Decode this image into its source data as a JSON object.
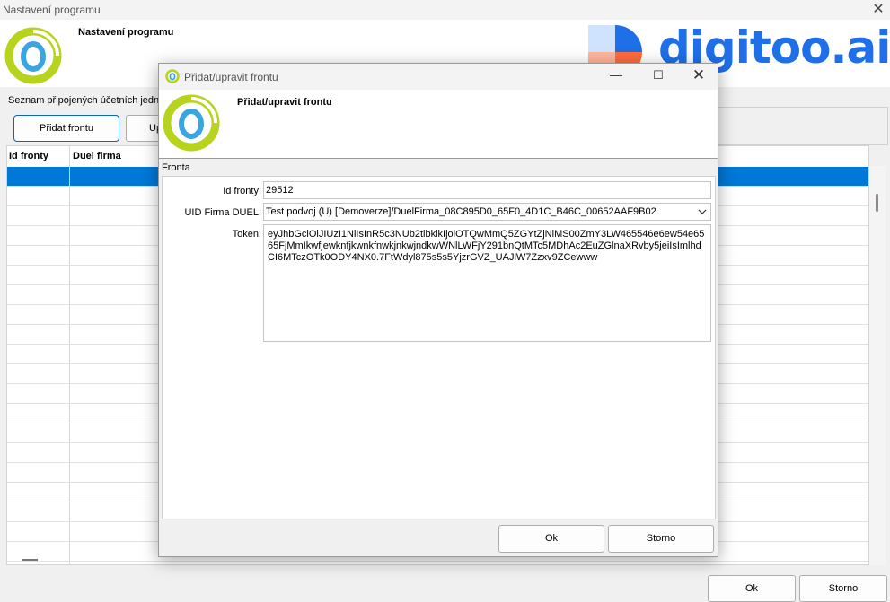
{
  "main_window": {
    "title": "Nastavení programu",
    "header_title": "Nastavení programu",
    "list_caption": "Seznam připojených účetních jedno",
    "add_queue_label": "Přidat frontu",
    "edit_queue_label": "Up",
    "grid_columns": [
      "Id fronty",
      "Duel firma"
    ],
    "ok_label": "Ok",
    "storno_label": "Storno"
  },
  "brand": {
    "text": "digitoo.ai",
    "color": "#1e6fe8"
  },
  "dialog": {
    "title": "Přidat/upravit frontu",
    "header_title": "Přidat/upravit frontu",
    "group_label": "Fronta",
    "fields": {
      "id_label": "Id fronty:",
      "id_value": "29512",
      "uid_label": "UID Firma DUEL:",
      "uid_value": "Test podvoj (U) [Demoverze]/DuelFirma_08C895D0_65F0_4D1C_B46C_00652AAF9B02",
      "token_label": "Token:",
      "token_value": "eyJhbGciOiJIUzI1NiIsInR5c3NUb2tlbklkIjoiOTQwMmQ5ZGYtZjNiMS00ZmY3LW465546e6ew54e6565FjMmIkwfjewknfjkwnkfnwkjnkwjndkwWNlLWFjY291bnQtMTc5MDhAc2EuZGlnaXRvby5jeiIsImlhdCI6MTczOTk0ODY4NX0.7FtWdyl875s5s5YjzrGVZ_UAJlW7Zzxv9ZCewww"
    },
    "ok_label": "Ok",
    "storno_label": "Storno"
  },
  "colors": {
    "selection": "#0078d7",
    "logo_ring": "#b7d31e",
    "logo_center": "#3aa5de"
  }
}
